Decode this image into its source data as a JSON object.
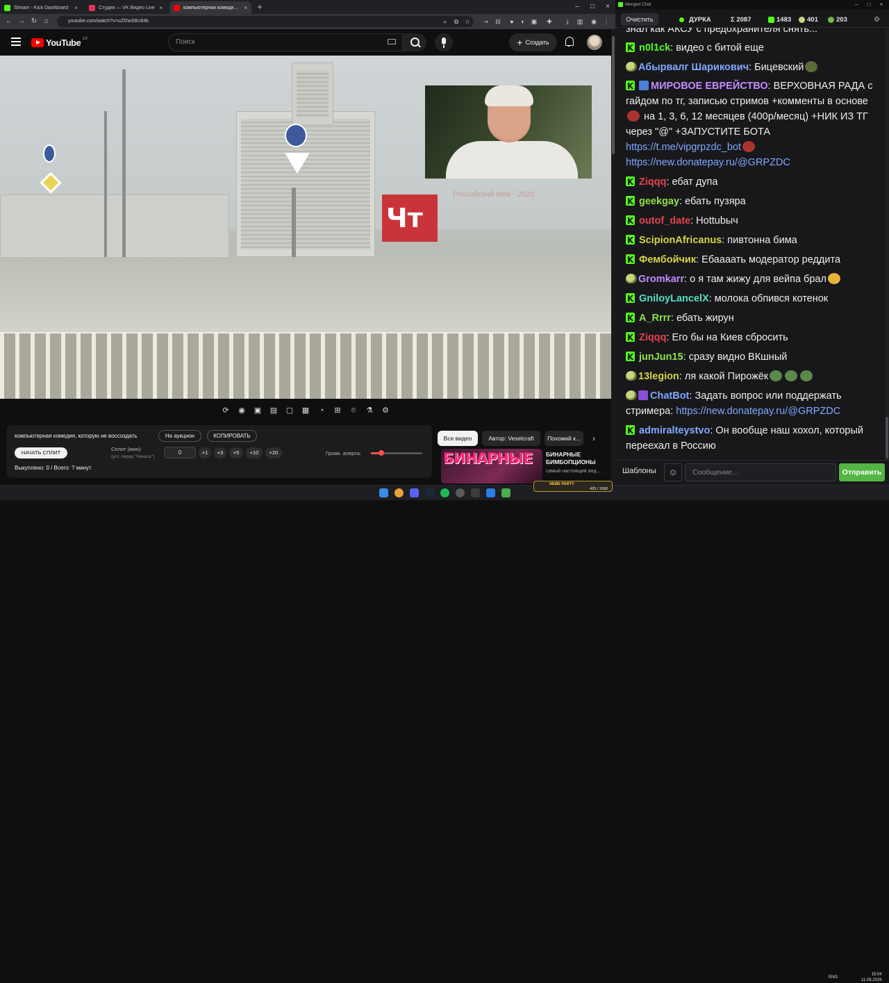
{
  "browser": {
    "tabs": [
      {
        "title": "Stream - Kick Dashboard",
        "color": "#53fc18",
        "active": false
      },
      {
        "title": "Студия — VK Видео Live",
        "color": "#e0315f",
        "active": false
      },
      {
        "title": "компьютерная комедия, котор...",
        "color": "#ff0000",
        "active": true
      }
    ],
    "url": "youtube.com/watch?v=uZf2wS8U84k"
  },
  "youtube": {
    "logo_text": "YouTube",
    "country": "LV",
    "search_placeholder": "Поиск",
    "create_label": "Создать"
  },
  "video": {
    "sign_text": "Чт",
    "watermark": "Российский мем · 2020",
    "player_controls": [
      "loop-icon",
      "broadcast-icon",
      "eye-box-icon",
      "clapper-icon",
      "frame-icon",
      "film-icon",
      "speed-icon",
      "add-box-icon",
      "camera-icon",
      "flask-icon",
      "gear-icon"
    ]
  },
  "panel": {
    "title": "компьютерная комедия, которую не воссоздать",
    "auction_label": "На аукцион",
    "copy_label": "КОПИРОВАТЬ",
    "start_split_label": "НАЧАТЬ СПЛИТ",
    "split_label": "Сплит (мин):",
    "split_hint": "(уст. перед \"Начать\")",
    "split_value": "0",
    "split_steps": [
      "+1",
      "+3",
      "+5",
      "+10",
      "+20"
    ],
    "volume_label": "Громк. алерта:",
    "volume_level": 0.2,
    "bought": "Выкуплено: 0 / Всего: ? минут"
  },
  "related": {
    "chips": [
      "Все видео",
      "Автор: Veselcraft",
      "Похожий к..."
    ],
    "thumb_text": "БИНАРНЫЕ",
    "title": "БИНАРНЫЕ БИМБОПЦИОНЫ",
    "desc": "самый настоящий анд..."
  },
  "chat": {
    "window_title": "Merged Chat",
    "clear_label": "Очистить",
    "channel": "ДУРКА",
    "total_label": "Σ 2087",
    "kick_count": "1483",
    "vk_count": "401",
    "other_count": "203",
    "messages": [
      {
        "badge": "none",
        "user": "",
        "user_color": "#efeff1",
        "text": "знал как АКСУ с предохранителя снять..."
      },
      {
        "badge": "kick",
        "user": "n0l1ck",
        "user_color": "#53fc18",
        "text": ": видео с битой еще"
      },
      {
        "badge": "frog",
        "user": "Абырвалг Шарикович",
        "user_color": "#7fa9ff",
        "text": ": Бицевский"
      },
      {
        "badge": "kick",
        "user": "МИРОВОЕ ЕВРЕЙСТВО",
        "user_color": "#c48cff",
        "text": ": ВЕРХОВНАЯ РАДА с гайдом по тг, записью стримов +комменты в основе",
        "text2": " на 1, 3, 6, 12 месяцев (400р/месяц) +НИК ИЗ ТГ через \"@\" +ЗАПУСТИТЕ БОТА",
        "link1": "https://t.me/vipgrpzdc_bot",
        "link2": "https://new.donatepay.ru/@GRPZDC"
      },
      {
        "badge": "kick",
        "user": "Ziqqq",
        "user_color": "#e0434d",
        "text": ": ебат дупа"
      },
      {
        "badge": "kick",
        "user": "geekgay",
        "user_color": "#8fe04a",
        "text": ": ебать пузяра"
      },
      {
        "badge": "kick",
        "user": "outof_date",
        "user_color": "#e0434d",
        "text": ": Hottubыч"
      },
      {
        "badge": "kick",
        "user": "ScipionAfricanus",
        "user_color": "#d6d24a",
        "text": ": пивтонна бима"
      },
      {
        "badge": "kick",
        "user": "Фембойчик",
        "user_color": "#d6d24a",
        "text": ": Ебаааать модератор реддита"
      },
      {
        "badge": "frog",
        "user": "Gromkarr",
        "user_color": "#c48cff",
        "text": ": о я там жижу для вейпа брал"
      },
      {
        "badge": "kick",
        "user": "GniloyLancelX",
        "user_color": "#53e0c0",
        "text": ": молока обпився котенок"
      },
      {
        "badge": "kick",
        "user": "A_Rrrr",
        "user_color": "#8fe04a",
        "text": ": ебать жирун"
      },
      {
        "badge": "kick",
        "user": "Ziqqq",
        "user_color": "#e0434d",
        "text": ": Его бы на Киев сбросить"
      },
      {
        "badge": "kick",
        "user": "junJun15",
        "user_color": "#8fe04a",
        "text": ": сразу видно ВКшный"
      },
      {
        "badge": "frog",
        "user": "13legion",
        "user_color": "#d6d24a",
        "text": ": ля какой  Пирожёк"
      },
      {
        "badge": "frog",
        "user": "ChatBot",
        "user_color": "#7fa9ff",
        "text": ": Задать вопрос или поддержать стримера: ",
        "link1": "https://new.donatepay.ru/@GRPZDC"
      },
      {
        "badge": "kick",
        "user": "admiralteystvo",
        "user_color": "#7fa9ff",
        "text": ": Он вообще наш хохол, который переехал в Россию"
      }
    ],
    "templates_label": "Шаблоны",
    "input_placeholder": "Сообщение...",
    "send_label": "Отправить"
  },
  "taskbar": {
    "now_playing": "NEME PARTY",
    "now_playing_progress": "425 / 1500",
    "lang": "ENG",
    "time": "15:04",
    "date": "11.08.2026"
  }
}
